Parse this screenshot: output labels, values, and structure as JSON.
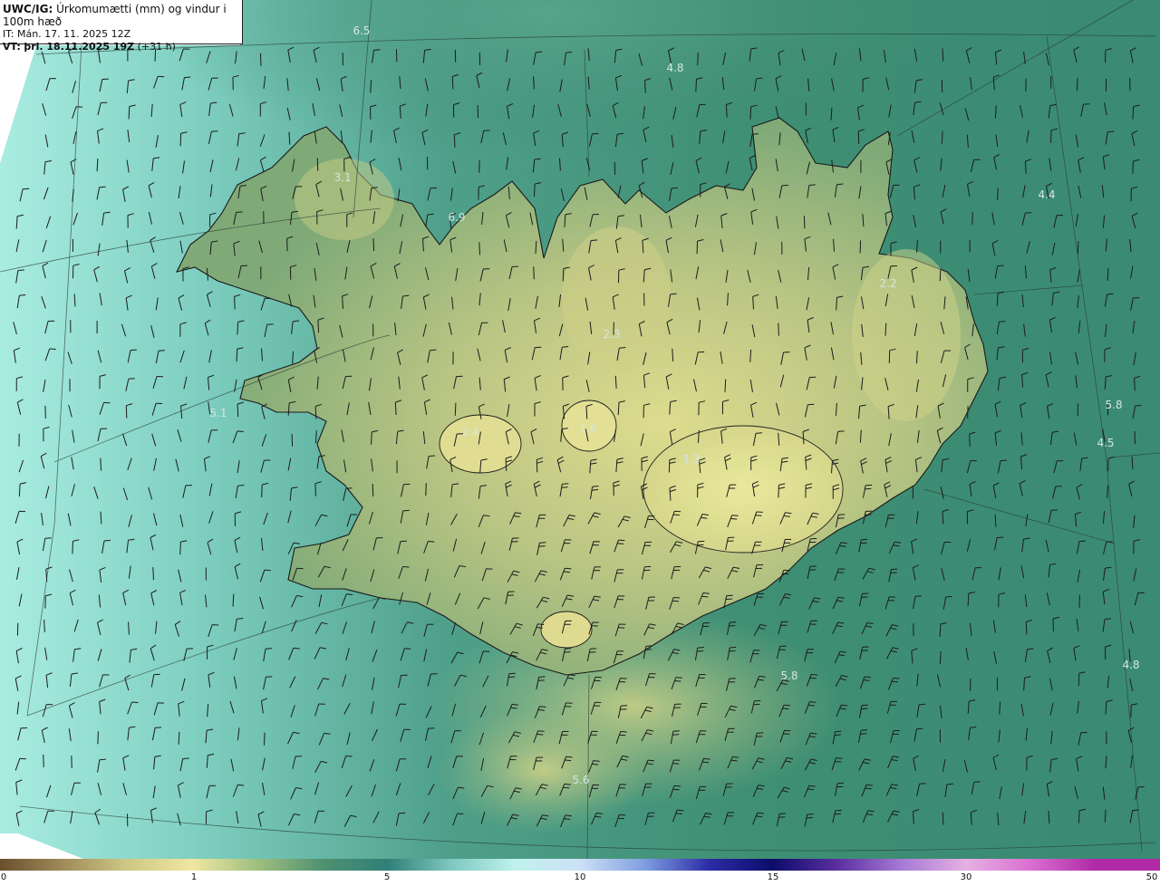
{
  "header": {
    "product": "UWC/IG:",
    "description": "Úrkomumætti (mm) og vindur i 100m hæð",
    "init_time": "IT: Mán. 17. 11. 2025 12Z",
    "valid_prefix": "VT:",
    "valid_time": "þri. 18.11.2025 19Z",
    "valid_offset": "(+31 h)"
  },
  "field_labels": [
    "6.5",
    "4.8",
    "3.1",
    "6.9",
    "4.4",
    "2.2",
    "2.3",
    "5.8",
    "4.5",
    "5.1",
    "2.4",
    "1.6",
    "1.3",
    "5.8",
    "4.8",
    "5.6"
  ],
  "colorbar": {
    "ticks": [
      "0",
      "1",
      "5",
      "10",
      "15",
      "30",
      "50"
    ],
    "colors": [
      "#6b4f2e",
      "#a08d5a",
      "#cfc986",
      "#efe6a2",
      "#9fbf7e",
      "#4f9170",
      "#2f8078",
      "#7ec8c0",
      "#c0f2ec",
      "#cde0f7",
      "#7f9fe0",
      "#2c2ca8",
      "#0c0c6a",
      "#5b2fa0",
      "#a77bd6",
      "#e7b0e3",
      "#d96ed0",
      "#b02aa6"
    ]
  },
  "colors": {
    "land_high": "#d9d88a",
    "land_low": "#8fb07a",
    "sea_mid": "#3c8c76",
    "sea_light": "#8fd8cc",
    "coast": "#1a1a1a",
    "barb": "#1c1c1c"
  }
}
